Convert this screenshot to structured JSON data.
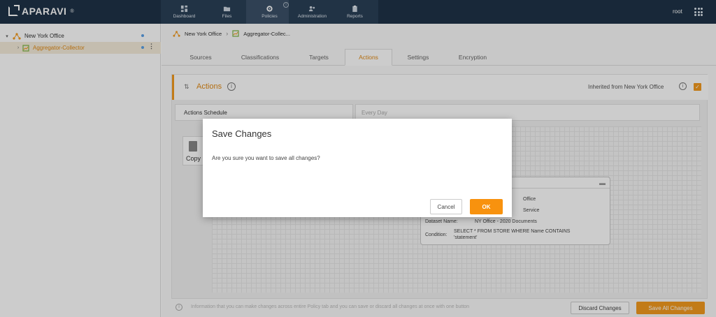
{
  "brand": {
    "name": "APARAVI",
    "mark": "®"
  },
  "nav": [
    {
      "label": "Dashboard",
      "icon": "dashboard-icon"
    },
    {
      "label": "Files",
      "icon": "folder-icon"
    },
    {
      "label": "Policies",
      "icon": "gear-icon"
    },
    {
      "label": "Administration",
      "icon": "users-icon"
    },
    {
      "label": "Reports",
      "icon": "clipboard-icon"
    }
  ],
  "user": {
    "name": "root"
  },
  "sidebar": {
    "items": [
      {
        "label": "New York Office",
        "icon": "hierarchy-icon"
      },
      {
        "label": "Aggregator-Collector",
        "icon": "collector-icon",
        "selected": true
      }
    ]
  },
  "breadcrumb": [
    {
      "label": "New York Office"
    },
    {
      "label": "Aggregator-Collec..."
    }
  ],
  "tabs": [
    {
      "label": "Sources"
    },
    {
      "label": "Classifications"
    },
    {
      "label": "Targets"
    },
    {
      "label": "Actions",
      "active": true
    },
    {
      "label": "Settings"
    },
    {
      "label": "Encryption"
    }
  ],
  "actions_panel": {
    "title": "Actions",
    "inherited_label": "Inherited from New York Office",
    "inherited_checked": true,
    "schedule_label": "Actions Schedule",
    "schedule_value": "Every Day",
    "copy_label": "Copy",
    "card": {
      "line1": "Office",
      "line2": "Service",
      "dataset_label": "Dataset Name:",
      "dataset_value": "NY Office - 2020 Documents",
      "condition_label": "Condition:",
      "condition_value": "SELECT * FROM STORE WHERE Name CONTAINS",
      "condition_value2": "'statement'"
    }
  },
  "footer": {
    "info_text": "Information that you can make changes across entire Policy tab and you can save or discard all changes at once with one button",
    "discard_label": "Discard Changes",
    "save_all_label": "Save All Changes"
  },
  "modal": {
    "title": "Save Changes",
    "message": "Are you sure you want to save all changes?",
    "cancel_label": "Cancel",
    "ok_label": "OK"
  },
  "colors": {
    "accent": "#f39a1e",
    "topbar": "#1e3348"
  }
}
